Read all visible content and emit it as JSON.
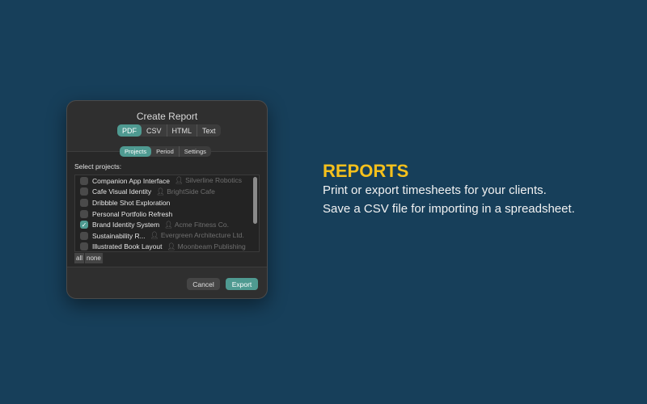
{
  "dialog": {
    "title": "Create Report",
    "formats": [
      "PDF",
      "CSV",
      "HTML",
      "Text"
    ],
    "tabs": [
      "Projects",
      "Period",
      "Settings"
    ],
    "select_label": "Select projects:",
    "projects": [
      {
        "name": "Companion App Interface",
        "client": "Silverline Robotics",
        "checked": false
      },
      {
        "name": "Cafe Visual Identity",
        "client": "BrightSide Cafe",
        "checked": false
      },
      {
        "name": "Dribbble Shot Exploration",
        "client": "",
        "checked": false
      },
      {
        "name": "Personal Portfolio Refresh",
        "client": "",
        "checked": false
      },
      {
        "name": "Brand Identity System",
        "client": "Acme Fitness Co.",
        "checked": true
      },
      {
        "name": "Sustainability R...",
        "client": "Evergreen Architecture Ltd.",
        "checked": false
      },
      {
        "name": "Illustrated Book Layout",
        "client": "Moonbeam Publishing",
        "checked": false
      }
    ],
    "all_label": "all",
    "none_label": "none",
    "cancel_label": "Cancel",
    "export_label": "Export"
  },
  "promo": {
    "heading": "REPORTS",
    "line1": "Print or export timesheets for your clients.",
    "line2": "Save a CSV file for importing in a spreadsheet."
  }
}
